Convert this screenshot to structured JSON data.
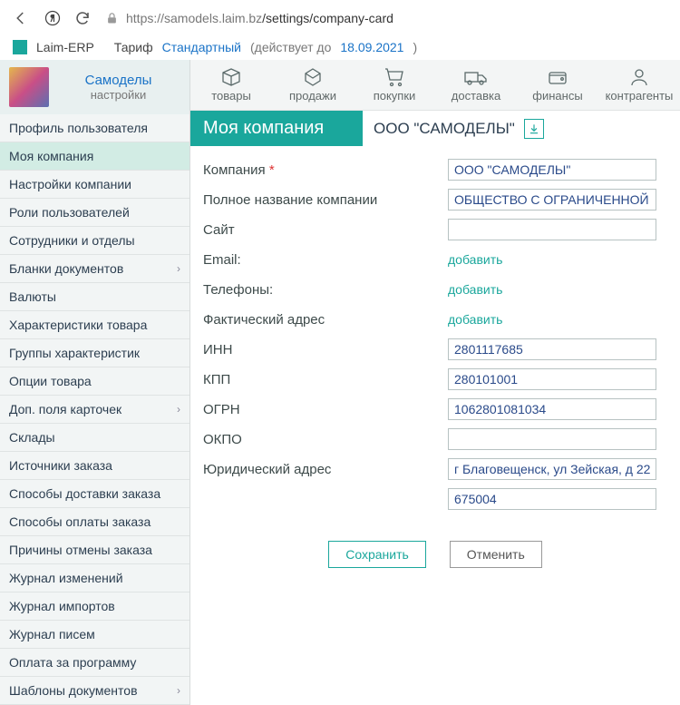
{
  "browser": {
    "url_host": "https://samodels.laim.bz",
    "url_path": "/settings/company-card"
  },
  "appbar": {
    "appname": "Laim-ERP",
    "tariff_label": "Тариф",
    "plan": "Стандартный",
    "until_prefix": "(действует до",
    "until_date": "18.09.2021",
    "until_suffix": ")"
  },
  "sidebar": {
    "brand": "Самоделы",
    "brand_sub": "настройки",
    "items": [
      {
        "label": "Профиль пользователя",
        "active": false,
        "chev": false
      },
      {
        "label": "Моя компания",
        "active": true,
        "chev": false
      },
      {
        "label": "Настройки компании",
        "active": false,
        "chev": false
      },
      {
        "label": "Роли пользователей",
        "active": false,
        "chev": false
      },
      {
        "label": "Сотрудники и отделы",
        "active": false,
        "chev": false
      },
      {
        "label": "Бланки документов",
        "active": false,
        "chev": true
      },
      {
        "label": "Валюты",
        "active": false,
        "chev": false
      },
      {
        "label": "Характеристики товара",
        "active": false,
        "chev": false
      },
      {
        "label": "Группы характеристик",
        "active": false,
        "chev": false
      },
      {
        "label": "Опции товара",
        "active": false,
        "chev": false
      },
      {
        "label": "Доп. поля карточек",
        "active": false,
        "chev": true
      },
      {
        "label": "Склады",
        "active": false,
        "chev": false
      },
      {
        "label": "Источники заказа",
        "active": false,
        "chev": false
      },
      {
        "label": "Способы доставки заказа",
        "active": false,
        "chev": false
      },
      {
        "label": "Способы оплаты заказа",
        "active": false,
        "chev": false
      },
      {
        "label": "Причины отмены заказа",
        "active": false,
        "chev": false
      },
      {
        "label": "Журнал изменений",
        "active": false,
        "chev": false
      },
      {
        "label": "Журнал импортов",
        "active": false,
        "chev": false
      },
      {
        "label": "Журнал писем",
        "active": false,
        "chev": false
      },
      {
        "label": "Оплата за программу",
        "active": false,
        "chev": false
      },
      {
        "label": "Шаблоны документов",
        "active": false,
        "chev": true
      }
    ]
  },
  "topnav": [
    {
      "label": "товары"
    },
    {
      "label": "продажи"
    },
    {
      "label": "покупки"
    },
    {
      "label": "доставка"
    },
    {
      "label": "финансы"
    },
    {
      "label": "контрагенты"
    }
  ],
  "header": {
    "title": "Моя компания",
    "subtitle": "ООО \"САМОДЕЛЫ\""
  },
  "form": {
    "company_label": "Компания",
    "company_value": "ООО \"САМОДЕЛЫ\"",
    "fullname_label": "Полное название компании",
    "fullname_value": "ОБЩЕСТВО С ОГРАНИЧЕННОЙ ...",
    "site_label": "Сайт",
    "site_value": "",
    "email_label": "Email:",
    "email_add": "добавить",
    "phones_label": "Телефоны:",
    "phones_add": "добавить",
    "address_actual_label": "Фактический адрес",
    "address_actual_add": "добавить",
    "inn_label": "ИНН",
    "inn_value": "2801117685",
    "kpp_label": "КПП",
    "kpp_value": "280101001",
    "ogrn_label": "ОГРН",
    "ogrn_value": "1062801081034",
    "okpo_label": "ОКПО",
    "okpo_value": "",
    "legal_addr_label": "Юридический адрес",
    "legal_addr_value": "г Благовещенск, ул Зейская, д 22...",
    "legal_zip_value": "675004"
  },
  "buttons": {
    "save": "Сохранить",
    "cancel": "Отменить"
  }
}
